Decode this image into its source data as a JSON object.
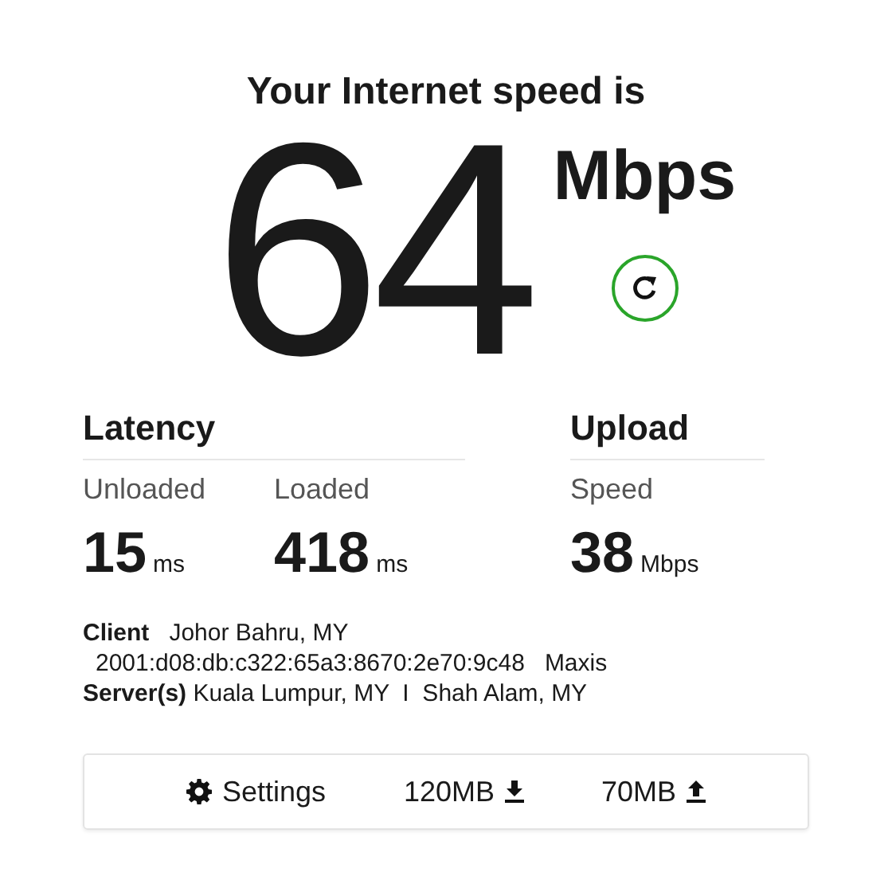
{
  "title": "Your Internet speed is",
  "speed": {
    "value": "64",
    "unit": "Mbps"
  },
  "latency": {
    "heading": "Latency",
    "metrics": [
      {
        "label": "Unloaded",
        "value": "15",
        "unit": "ms"
      },
      {
        "label": "Loaded",
        "value": "418",
        "unit": "ms"
      }
    ]
  },
  "upload": {
    "heading": "Upload",
    "metrics": [
      {
        "label": "Speed",
        "value": "38",
        "unit": "Mbps"
      }
    ]
  },
  "client": {
    "label": "Client",
    "location": "Johor Bahru, MY",
    "address": "2001:d08:db:c322:65a3:8670:2e70:9c48",
    "isp": "Maxis"
  },
  "servers": {
    "label": "Server(s)",
    "text": "Kuala Lumpur, MY  I  Shah Alam, MY"
  },
  "footer": {
    "settings": "Settings",
    "download_size": "120MB",
    "upload_size": "70MB"
  }
}
